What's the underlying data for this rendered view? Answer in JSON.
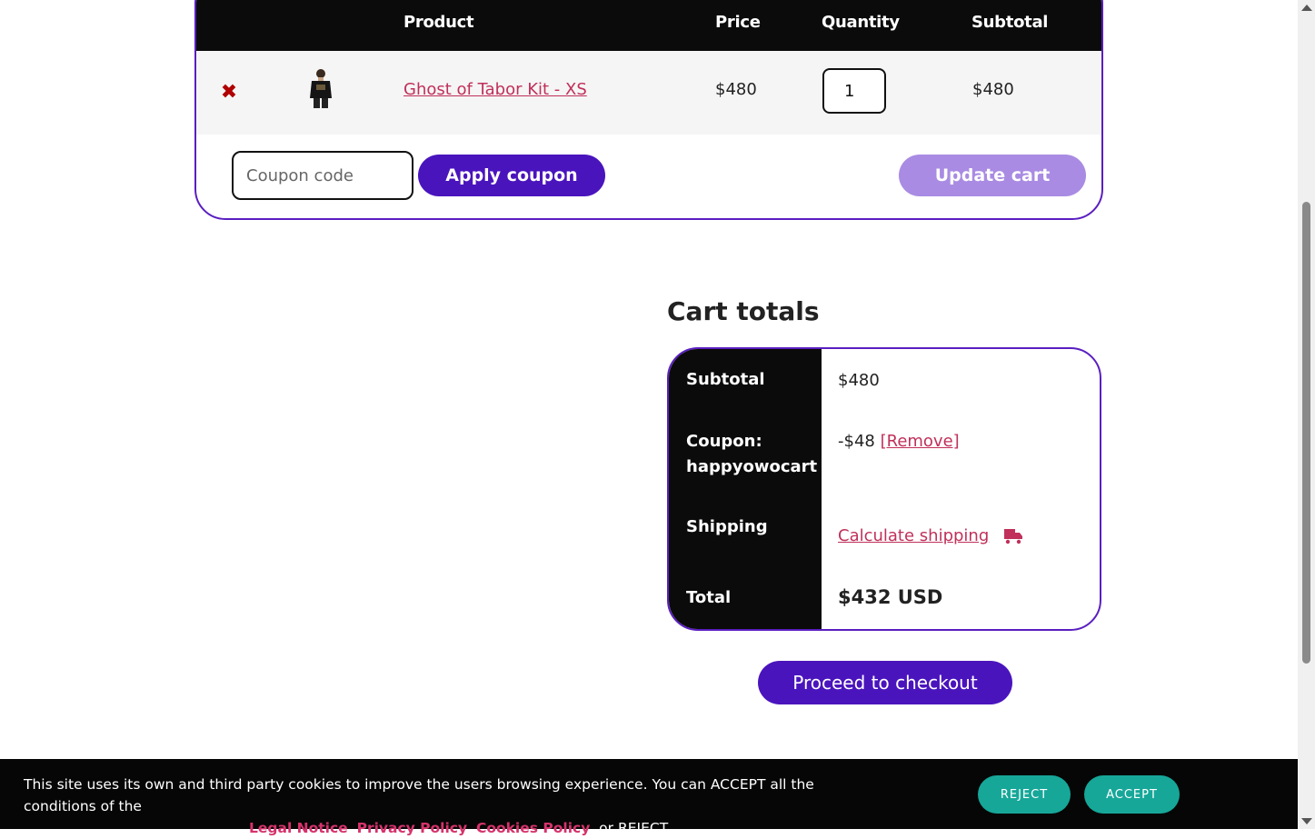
{
  "cart": {
    "headers": {
      "product": "Product",
      "price": "Price",
      "quantity": "Quantity",
      "subtotal": "Subtotal"
    },
    "items": [
      {
        "remove_glyph": "✖",
        "name": "Ghost of Tabor Kit - XS",
        "price": "$480",
        "quantity": "1",
        "subtotal": "$480"
      }
    ],
    "coupon_placeholder": "Coupon code",
    "apply_coupon_label": "Apply coupon",
    "update_cart_label": "Update cart"
  },
  "totals": {
    "title": "Cart totals",
    "subtotal_label": "Subtotal",
    "subtotal_value": "$480",
    "coupon_label_1": "Coupon:",
    "coupon_label_2": "happyowocart",
    "coupon_value": "-$48",
    "coupon_remove": "[Remove]",
    "shipping_label": "Shipping",
    "shipping_link": "Calculate shipping",
    "total_label": "Total",
    "total_value": "$432 USD",
    "checkout_label": "Proceed to checkout"
  },
  "cookie": {
    "text_1": "This site uses its own and third party cookies to improve the users browsing experience. You can ACCEPT all the conditions of the",
    "legal_notice": "Legal Notice",
    "sep_1": ",",
    "privacy_policy": "Privacy Policy",
    "sep_2": ",",
    "cookies_policy": "Cookies Policy",
    "text_end": ", or REJECT.",
    "reject_label": "REJECT",
    "accept_label": "ACCEPT"
  },
  "colors": {
    "brand_purple": "#4a14bd",
    "border_purple": "#5a1fc0",
    "link_pink": "#c0305a",
    "cookie_teal": "#16a799",
    "remove_red": "#b00000"
  },
  "icons": {
    "remove": "remove-x-icon",
    "shipping": "truck-icon",
    "scroll_up": "chevron-up-icon",
    "scroll_down": "chevron-down-icon"
  }
}
